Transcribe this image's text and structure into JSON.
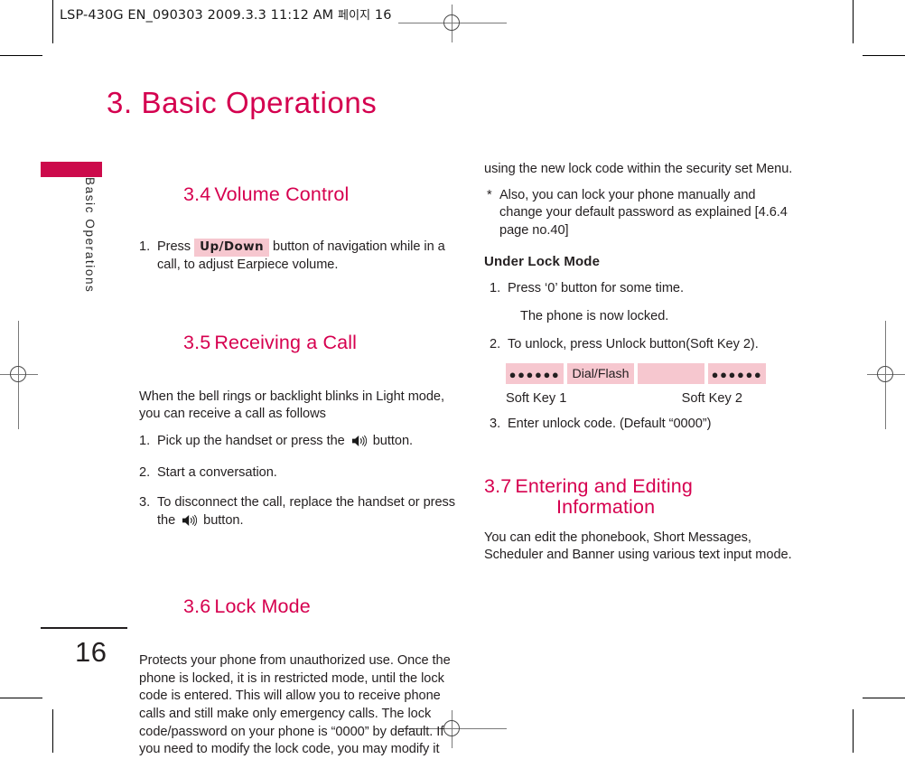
{
  "print_slug": {
    "text": "LSP-430G EN_090303  2009.3.3 11:12 AM",
    "korean": "페이지",
    "page_ref": "16"
  },
  "chapter": {
    "title": "3. Basic Operations"
  },
  "side_tab": {
    "label": "Basic Operations",
    "bar_color": "#cc0a4b"
  },
  "footer": {
    "page_number": "16"
  },
  "colors": {
    "heading_crimson": "#d6004f",
    "badge_pink": "#f6c7cf",
    "body_black": "#231f20"
  },
  "left_column": {
    "section_34": {
      "number": "3.4",
      "title": "Volume Control",
      "steps": [
        {
          "marker": "1.",
          "pre": "Press",
          "badge": "Up/Down",
          "post": "button of navigation while in a call, to adjust Earpiece volume."
        }
      ]
    },
    "section_35": {
      "number": "3.5",
      "title": "Receiving a Call",
      "intro": "When the bell rings or backlight blinks in Light mode, you can receive a call  as follows",
      "steps": [
        {
          "marker": "1.",
          "pre": "Pick up the handset or press the",
          "icon": "speaker-icon",
          "post": "button."
        },
        {
          "marker": "2.",
          "pre": "Start a conversation.",
          "icon": "",
          "post": ""
        },
        {
          "marker": "3.",
          "pre": "To disconnect the call, replace the handset or press the",
          "icon": "speaker-icon",
          "post": "button."
        }
      ]
    },
    "section_36": {
      "number": "3.6",
      "title": "Lock Mode",
      "body": "Protects your phone from unauthorized use. Once the phone is locked, it is in restricted mode, until the lock code is entered. This will allow you to receive phone calls and still make only emergency calls. The lock code/password on your phone is “0000” by default. If you need to modify the lock code, you may modify it"
    }
  },
  "right_column": {
    "continuation": "using the new lock code within the  security set Menu.",
    "note": {
      "star": "*",
      "text": "Also, you can lock your phone manually and change your default password as explained [4.6.4 page no.40]"
    },
    "under_lock_mode": {
      "heading": "Under Lock Mode",
      "steps": [
        {
          "marker": "1.",
          "text": "Press ‘0’ button for some time."
        },
        {
          "marker": "",
          "text": "The phone is now locked."
        },
        {
          "marker": "2.",
          "text": "To unlock, press Unlock button(Soft Key 2)."
        }
      ],
      "diagram": {
        "cells": [
          {
            "type": "dots",
            "text": "●●●●●●"
          },
          {
            "type": "label",
            "text": "Dial/Flash"
          },
          {
            "type": "blank",
            "text": ""
          },
          {
            "type": "dots",
            "text": "●●●●●●"
          }
        ],
        "left_label": "Soft Key 1",
        "right_label": "Soft Key 2"
      },
      "final_step": {
        "marker": "3.",
        "text": "Enter unlock code. (Default “0000”)"
      }
    },
    "section_37": {
      "number": "3.7",
      "title_line1": "Entering and Editing",
      "title_line2": "Information",
      "body": "You can edit the phonebook, Short Messages, Scheduler and Banner using various text input mode."
    }
  }
}
